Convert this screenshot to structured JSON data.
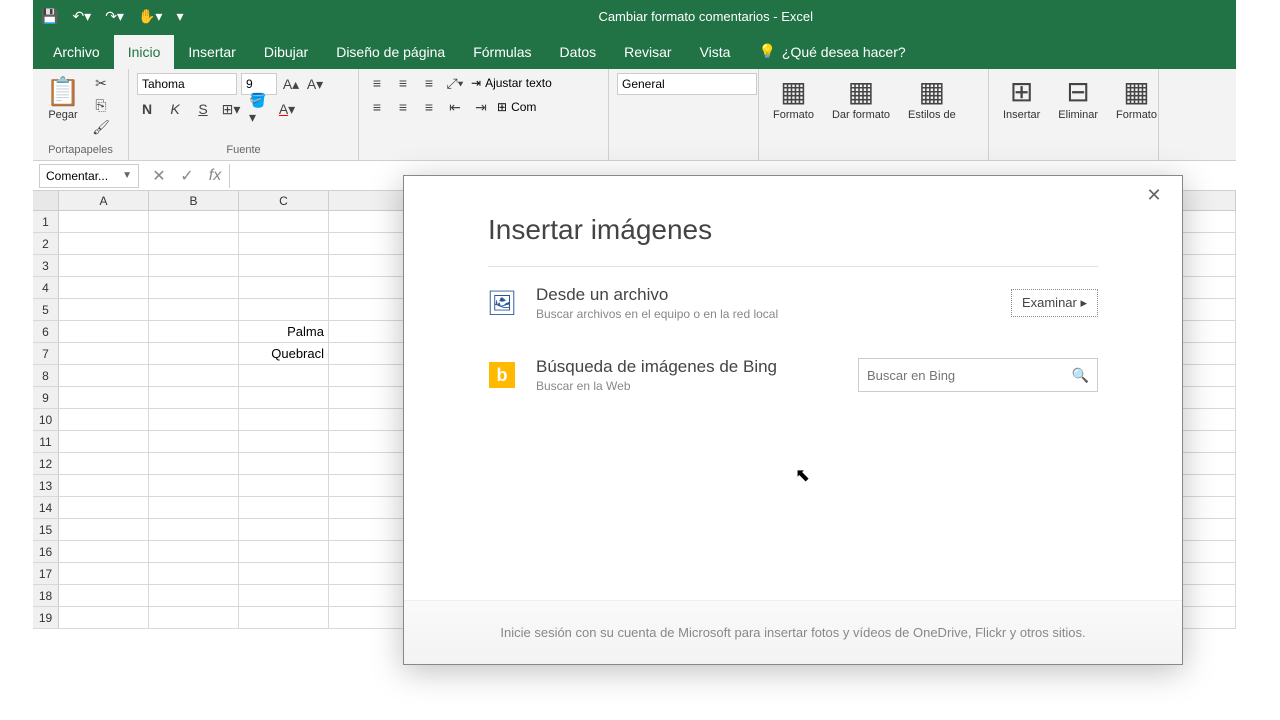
{
  "titlebar": {
    "document_name": "Cambiar formato comentarios - Excel"
  },
  "tabs": {
    "file": "Archivo",
    "home": "Inicio",
    "insert": "Insertar",
    "draw": "Dibujar",
    "pagelayout": "Diseño de página",
    "formulas": "Fórmulas",
    "data": "Datos",
    "review": "Revisar",
    "view": "Vista",
    "tell_me": "¿Qué desea hacer?"
  },
  "ribbon": {
    "clipboard": {
      "label": "Portapapeles",
      "paste": "Pegar"
    },
    "font": {
      "label": "Fuente",
      "name": "Tahoma",
      "size": "9",
      "bold": "N",
      "italic": "K",
      "underline": "S"
    },
    "alignment": {
      "wrap": "Ajustar texto",
      "merge": "Com"
    },
    "number": {
      "label": "General"
    },
    "styles": {
      "cond": "Formato",
      "table": "Dar formato",
      "cell": "Estilos de"
    },
    "cells": {
      "insert": "Insertar",
      "delete": "Eliminar",
      "format": "Formato"
    }
  },
  "namebox": {
    "value": "Comentar..."
  },
  "columns": [
    "A",
    "B",
    "C"
  ],
  "rows": [
    "1",
    "2",
    "3",
    "4",
    "5",
    "6",
    "7",
    "8",
    "9",
    "10",
    "11",
    "12",
    "13",
    "14",
    "15",
    "16",
    "17",
    "18",
    "19"
  ],
  "cells": {
    "C6": "Palma",
    "C7": "Quebracl"
  },
  "dialog": {
    "title": "Insertar imágenes",
    "from_file": {
      "title": "Desde un archivo",
      "sub": "Buscar archivos en el equipo o en la red local",
      "browse": "Examinar ▸"
    },
    "bing": {
      "title": "Búsqueda de imágenes de Bing",
      "sub": "Buscar en la Web",
      "placeholder": "Buscar en Bing"
    },
    "footer": "Inicie sesión con su cuenta de Microsoft para insertar fotos y vídeos de OneDrive, Flickr y otros sitios."
  }
}
